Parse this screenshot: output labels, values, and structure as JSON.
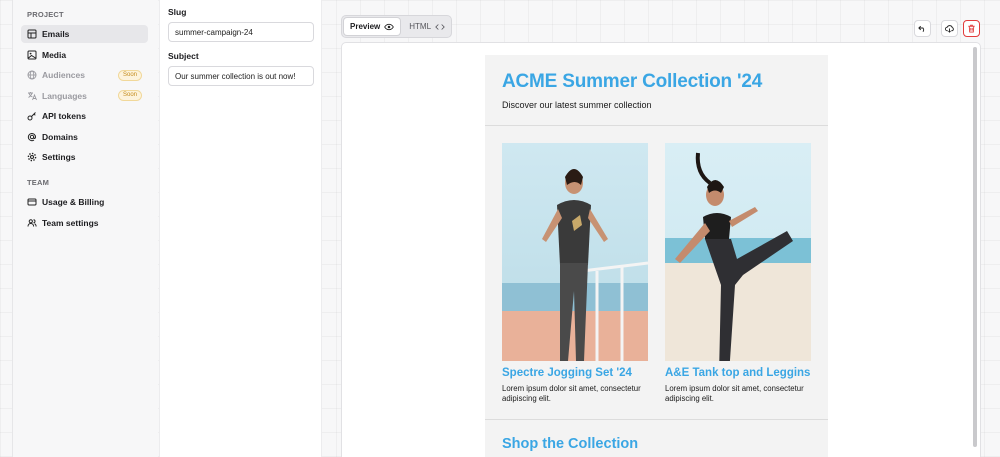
{
  "sidebar": {
    "project_label": "PROJECT",
    "team_label": "TEAM",
    "project_items": [
      {
        "label": "Emails",
        "icon": "table-icon",
        "active": true
      },
      {
        "label": "Media",
        "icon": "image-icon"
      },
      {
        "label": "Audiences",
        "icon": "globe-icon",
        "badge": "Soon"
      },
      {
        "label": "Languages",
        "icon": "translate-icon",
        "badge": "Soon"
      },
      {
        "label": "API tokens",
        "icon": "key-icon"
      },
      {
        "label": "Domains",
        "icon": "at-icon"
      },
      {
        "label": "Settings",
        "icon": "gear-icon"
      }
    ],
    "team_items": [
      {
        "label": "Usage & Billing",
        "icon": "credit-card-icon"
      },
      {
        "label": "Team settings",
        "icon": "users-icon"
      }
    ]
  },
  "form": {
    "slug_label": "Slug",
    "slug_value": "summer-campaign-24",
    "subject_label": "Subject",
    "subject_value": "Our summer collection is out now!"
  },
  "toolbar": {
    "preview_label": "Preview",
    "html_label": "HTML",
    "actions": [
      "undo-icon",
      "cloud-download-icon",
      "trash-icon"
    ]
  },
  "email": {
    "title": "ACME Summer Collection '24",
    "subtitle": "Discover our latest summer collection",
    "products": [
      {
        "title": "Spectre Jogging Set '24",
        "desc": "Lorem ipsum dolor sit amet, consectetur adipiscing elit."
      },
      {
        "title": "A&E Tank top and Leggins",
        "desc": "Lorem ipsum dolor sit amet, consectetur adipiscing elit."
      }
    ],
    "shop_title": "Shop the Collection"
  },
  "colors": {
    "accent_blue": "#3aa6e4",
    "danger_red": "#e23c3c",
    "badge_text": "#c28a1b"
  }
}
